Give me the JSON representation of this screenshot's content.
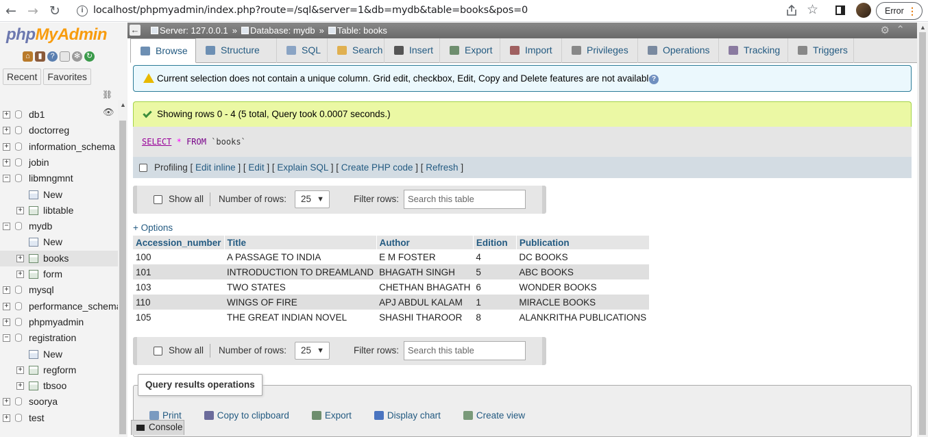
{
  "browser": {
    "url": "localhost/phpmyadmin/index.php?route=/sql&server=1&db=mydb&table=books&pos=0",
    "error_label": "Error"
  },
  "nav": {
    "logo_php": "php",
    "logo_mya": "MyAdmin",
    "recent_label": "Recent",
    "favorites_label": "Favorites",
    "tree": [
      {
        "label": "db1",
        "type": "db",
        "expand": "+"
      },
      {
        "label": "doctorreg",
        "type": "db",
        "expand": "+"
      },
      {
        "label": "information_schema",
        "type": "db",
        "expand": "+"
      },
      {
        "label": "jobin",
        "type": "db",
        "expand": "+"
      },
      {
        "label": "libmngmnt",
        "type": "db",
        "expand": "−"
      },
      {
        "label": "New",
        "type": "new"
      },
      {
        "label": "libtable",
        "type": "table",
        "expand": "+"
      },
      {
        "label": "mydb",
        "type": "db",
        "expand": "−"
      },
      {
        "label": "New",
        "type": "new"
      },
      {
        "label": "books",
        "type": "table",
        "expand": "+",
        "selected": true
      },
      {
        "label": "form",
        "type": "table",
        "expand": "+"
      },
      {
        "label": "mysql",
        "type": "db",
        "expand": "+"
      },
      {
        "label": "performance_schema",
        "type": "db",
        "expand": "+"
      },
      {
        "label": "phpmyadmin",
        "type": "db",
        "expand": "+"
      },
      {
        "label": "registration",
        "type": "db",
        "expand": "−"
      },
      {
        "label": "New",
        "type": "new"
      },
      {
        "label": "regform",
        "type": "table",
        "expand": "+"
      },
      {
        "label": "tbsoo",
        "type": "table",
        "expand": "+"
      },
      {
        "label": "soorya",
        "type": "db",
        "expand": "+"
      },
      {
        "label": "test",
        "type": "db",
        "expand": "+"
      }
    ]
  },
  "breadcrumb": {
    "server": "Server: 127.0.0.1",
    "database": "Database: mydb",
    "table": "Table: books"
  },
  "tabs": [
    {
      "label": "Browse",
      "icon": "browse-icon",
      "color": "#6d8fb3"
    },
    {
      "label": "Structure",
      "icon": "structure-icon",
      "color": "#6d8fb3"
    },
    {
      "label": "SQL",
      "icon": "sql-icon",
      "color": "#8aa4c4"
    },
    {
      "label": "Search",
      "icon": "search-icon",
      "color": "#e0b050"
    },
    {
      "label": "Insert",
      "icon": "insert-icon",
      "color": "#555"
    },
    {
      "label": "Export",
      "icon": "export-icon",
      "color": "#6e8e6e"
    },
    {
      "label": "Import",
      "icon": "import-icon",
      "color": "#a06060"
    },
    {
      "label": "Privileges",
      "icon": "privileges-icon",
      "color": "#888"
    },
    {
      "label": "Operations",
      "icon": "wrench-icon",
      "color": "#7a8aa0"
    },
    {
      "label": "Tracking",
      "icon": "eye-icon",
      "color": "#8a7aa0"
    },
    {
      "label": "Triggers",
      "icon": "triggers-icon",
      "color": "#888"
    }
  ],
  "notice": "Current selection does not contain a unique column. Grid edit, checkbox, Edit, Copy and Delete features are not available.",
  "success": "Showing rows 0 - 4 (5 total, Query took 0.0007 seconds.)",
  "sql": {
    "select": "SELECT",
    "star": "*",
    "from": "FROM",
    "table": "`books`"
  },
  "profiling": {
    "label": "Profiling",
    "links": [
      "Edit inline",
      "Edit",
      "Explain SQL",
      "Create PHP code",
      "Refresh"
    ]
  },
  "navigation": {
    "show_all": "Show all",
    "num_rows_label": "Number of rows:",
    "num_rows_value": "25",
    "filter_label": "Filter rows:",
    "filter_placeholder": "Search this table"
  },
  "options_link": "+ Options",
  "table": {
    "columns": [
      "Accession_number",
      "Title",
      "Author",
      "Edition",
      "Publication"
    ],
    "rows": [
      [
        "100",
        "A PASSAGE TO INDIA",
        "E M FOSTER",
        "4",
        "DC BOOKS"
      ],
      [
        "101",
        "INTRODUCTION TO DREAMLAND",
        "BHAGATH SINGH",
        "5",
        "ABC BOOKS"
      ],
      [
        "103",
        "TWO STATES",
        "CHETHAN BHAGATH",
        "6",
        "WONDER BOOKS"
      ],
      [
        "110",
        "WINGS OF FIRE",
        "APJ ABDUL KALAM",
        "1",
        "MIRACLE BOOKS"
      ],
      [
        "105",
        "THE GREAT INDIAN NOVEL",
        "SHASHI THAROOR",
        "8",
        "ALANKRITHA PUBLICATIONS"
      ]
    ]
  },
  "query_ops": {
    "legend": "Query results operations",
    "actions": [
      {
        "label": "Print",
        "icon": "print-icon",
        "color": "#7a9ac0"
      },
      {
        "label": "Copy to clipboard",
        "icon": "clipboard-icon",
        "color": "#6b6b9b"
      },
      {
        "label": "Export",
        "icon": "export-icon",
        "color": "#6e8e6e"
      },
      {
        "label": "Display chart",
        "icon": "chart-icon",
        "color": "#4a74c0"
      },
      {
        "label": "Create view",
        "icon": "view-icon",
        "color": "#7a9a7a"
      }
    ]
  },
  "console_label": "Console"
}
